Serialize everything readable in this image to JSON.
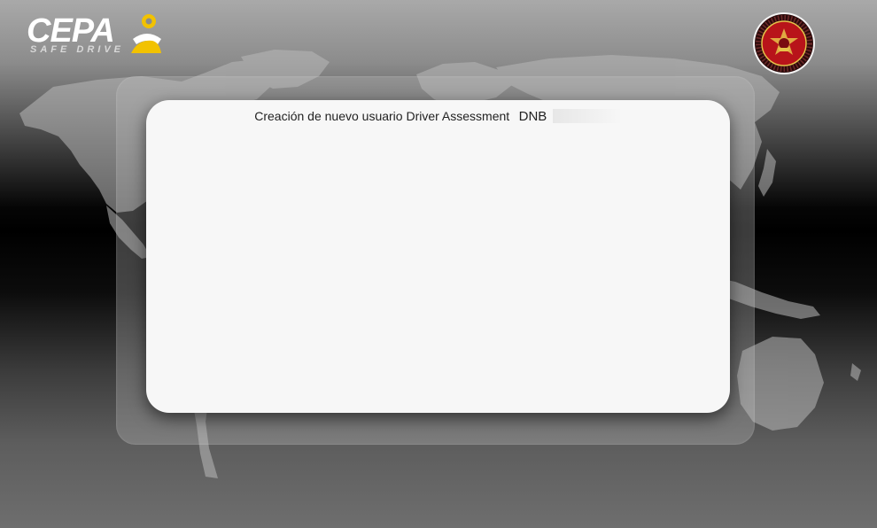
{
  "brand": {
    "logo_text": "CEPA",
    "tagline": "SAFE DRIVE",
    "accent_color": "#f2c200"
  },
  "emblem": {
    "name": "emblem-icon",
    "ring_text": "REPÚBLICA ORIENTAL DEL URUGUAY · DIRECCIÓN NACIONAL DE BOMBEROS"
  },
  "card": {
    "title": "Creación de nuevo usuario Driver Assessment",
    "title_code": "DNB"
  },
  "colors": {
    "card_background": "#f7f7f7",
    "panel_overlay": "#bebebe",
    "emblem_red": "#b8141a"
  }
}
